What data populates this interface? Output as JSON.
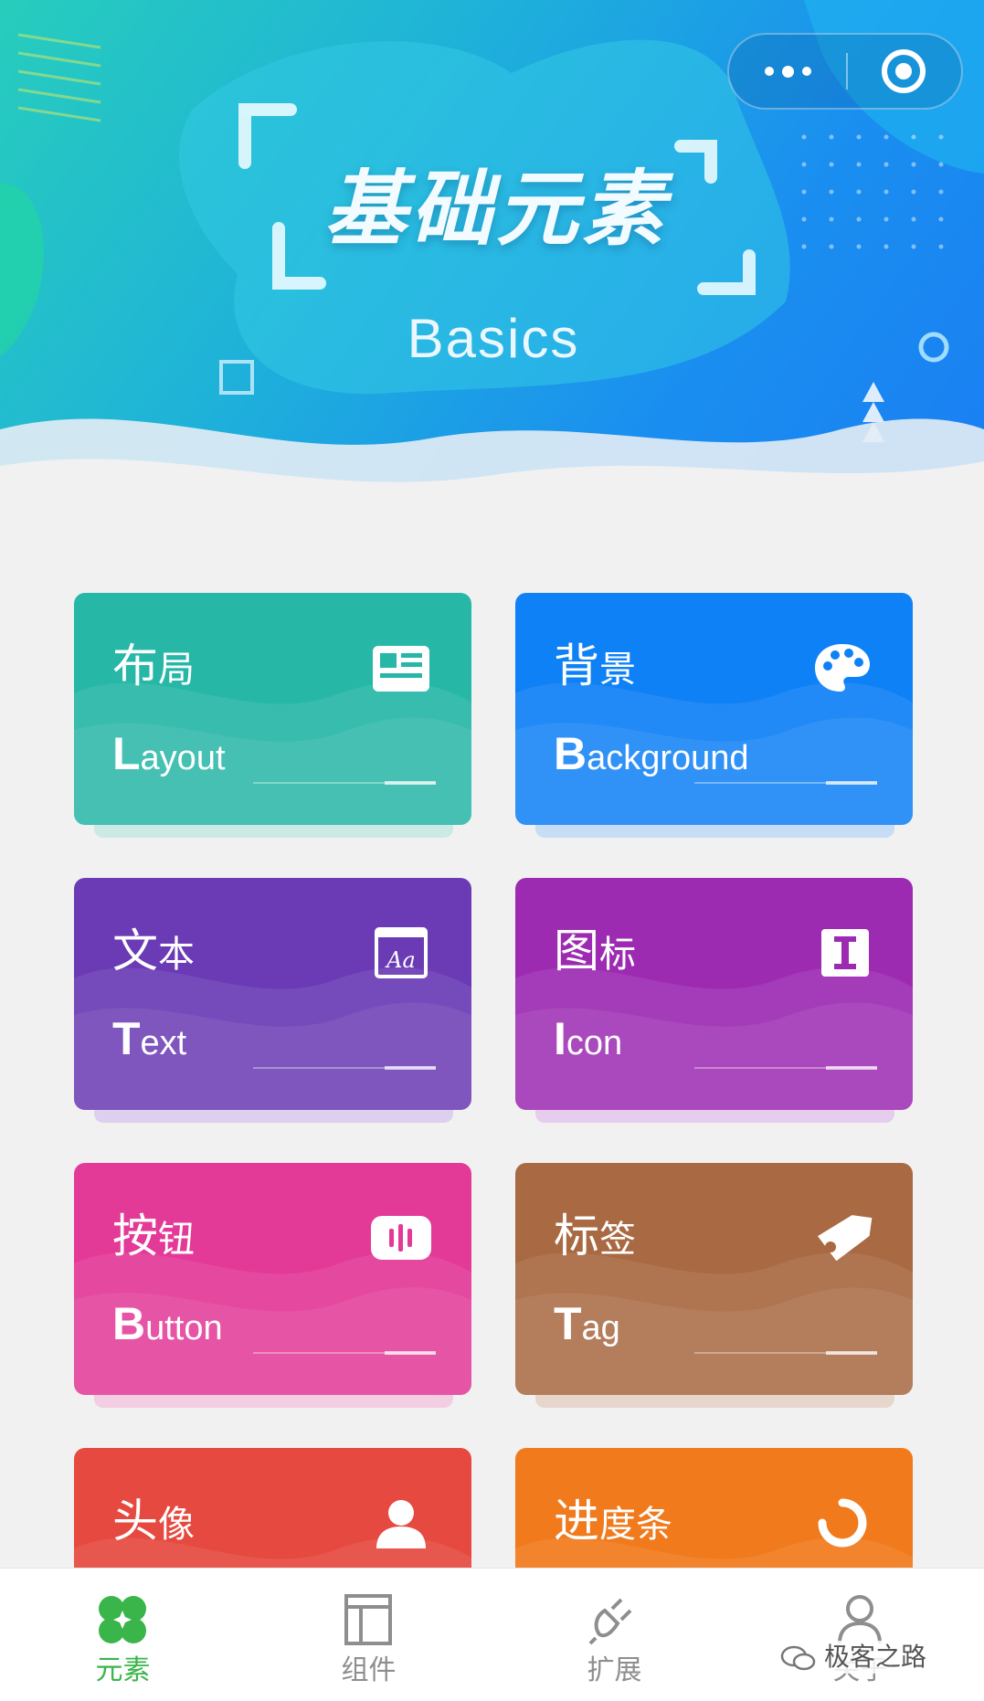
{
  "header": {
    "title_cn": "基础元素",
    "title_en": "Basics",
    "capsule": {
      "more_icon": "more-dots-icon",
      "close_icon": "target-circle-icon"
    }
  },
  "cards": [
    {
      "cn_big": "布",
      "cn_small": "局",
      "en_first": "L",
      "en_rest": "ayout",
      "icon": "layout-card-icon",
      "color": "#26b7a7"
    },
    {
      "cn_big": "背",
      "cn_small": "景",
      "en_first": "B",
      "en_rest": "ackground",
      "icon": "palette-icon",
      "color": "#0f81f6"
    },
    {
      "cn_big": "文",
      "cn_small": "本",
      "en_first": "T",
      "en_rest": "ext",
      "icon": "text-aa-icon",
      "color": "#6a3bb5"
    },
    {
      "cn_big": "图",
      "cn_small": "标",
      "en_first": "I",
      "en_rest": "con",
      "icon": "icon-i-icon",
      "color": "#9d2bb2"
    },
    {
      "cn_big": "按",
      "cn_small": "钮",
      "en_first": "B",
      "en_rest": "utton",
      "icon": "button-icon",
      "color": "#e33a97"
    },
    {
      "cn_big": "标",
      "cn_small": "签",
      "en_first": "T",
      "en_rest": "ag",
      "icon": "tag-icon",
      "color": "#a96942"
    },
    {
      "cn_big": "头",
      "cn_small": "像",
      "en_first": "",
      "en_rest": "",
      "icon": "avatar-icon",
      "color": "#e5493f"
    },
    {
      "cn_big": "进",
      "cn_small": "度条",
      "en_first": "",
      "en_rest": "",
      "icon": "progress-spinner-icon",
      "color": "#f07a1c"
    }
  ],
  "tabbar": {
    "tabs": [
      {
        "label": "元素",
        "icon": "elements-clover-icon",
        "active": true
      },
      {
        "label": "组件",
        "icon": "components-layout-icon",
        "active": false
      },
      {
        "label": "扩展",
        "icon": "extension-plug-icon",
        "active": false
      },
      {
        "label": "关于",
        "icon": "about-person-icon",
        "active": false
      }
    ]
  },
  "watermark": {
    "text": "极客之路",
    "icon": "wechat-icon"
  },
  "colors": {
    "accent": "#39b54a",
    "tab_inactive": "#8e8e8e"
  }
}
